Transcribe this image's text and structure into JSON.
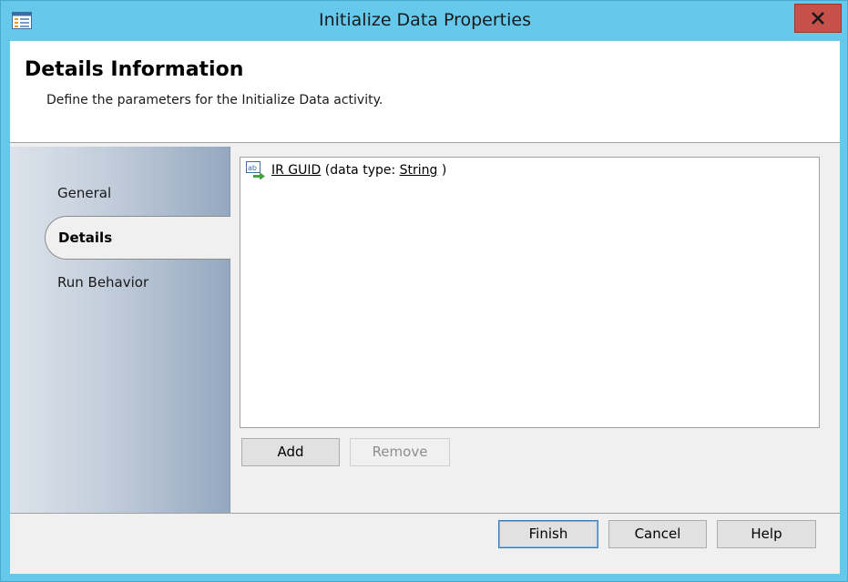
{
  "window": {
    "title": "Initialize Data Properties"
  },
  "header": {
    "title": "Details Information",
    "subtitle": "Define the parameters for the Initialize Data activity."
  },
  "nav": {
    "items": [
      {
        "label": "General",
        "active": false
      },
      {
        "label": "Details",
        "active": true
      },
      {
        "label": "Run Behavior",
        "active": false
      }
    ]
  },
  "parameters": [
    {
      "name": "IR GUID",
      "prefix": "(data type:",
      "type": "String",
      "suffix": ")"
    }
  ],
  "buttons": {
    "add": "Add",
    "remove": "Remove",
    "finish": "Finish",
    "cancel": "Cancel",
    "help": "Help"
  },
  "colors": {
    "titlebar": "#66c9ec",
    "close": "#c7504a",
    "nav_gradient_end": "#94a8bf"
  }
}
